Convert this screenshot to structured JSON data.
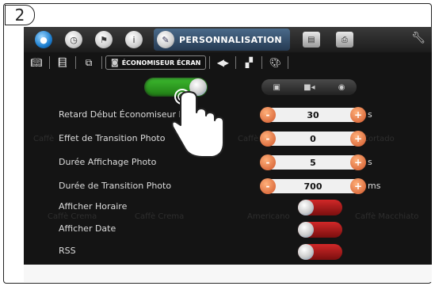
{
  "step_number": "2",
  "colors": {
    "accent_green": "#2e9e22",
    "toggle_off_red": "#b01c1c",
    "stepper_orange": "#e06a35"
  },
  "topbar": {
    "active_tab_label": "PERSONNALISATION",
    "icons": [
      "drop-icon",
      "clock-icon",
      "flag-icon",
      "info-icon",
      "pencil-icon",
      "screen-icon",
      "printer-icon",
      "wrench-icon"
    ]
  },
  "subbar": {
    "active_label": "ÉCONOMISEUR ÉCRAN"
  },
  "background_words": [
    "Caffè Crema",
    "Caffè Crema",
    "Americano",
    "Caffè Macchiato",
    "Caffè",
    "Caffè",
    "Cortado"
  ],
  "rows": [
    {
      "label": "Retard Début Économiseur Écran",
      "value": "30",
      "unit": "s"
    },
    {
      "label": "Effet de Transition Photo",
      "value": "0",
      "unit": ""
    },
    {
      "label": "Durée Affichage Photo",
      "value": "5",
      "unit": "s"
    },
    {
      "label": "Durée de Transition Photo",
      "value": "700",
      "unit": "ms"
    }
  ],
  "toggles": [
    {
      "label": "Afficher Horaire",
      "state": "off"
    },
    {
      "label": "Afficher Date",
      "state": "off"
    },
    {
      "label": "RSS",
      "state": "off"
    }
  ],
  "main_switch_state": "on"
}
